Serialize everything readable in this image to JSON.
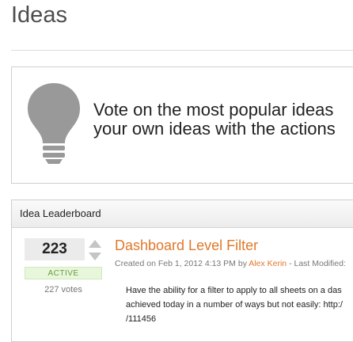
{
  "page": {
    "title": "Ideas"
  },
  "banner": {
    "line1": "Vote on the most popular ideas",
    "line2": "your own ideas with the actions"
  },
  "leaderboard": {
    "title": "Idea Leaderboard",
    "ideas": [
      {
        "vote_count": "223",
        "status": "ACTIVE",
        "votes_text": "227 votes",
        "title": "Dashboard Level Filter",
        "created_prefix": "Created on Feb 1, 2012 4:13 PM by",
        "author": "Alex Kerin",
        "modified_suffix": "- Last Modified:",
        "description_lines": [
          "Have the ability for a filter to apply to all sheets on a das",
          "achieved today in a number of ways but not easily: http:/",
          "/111456"
        ]
      }
    ]
  },
  "colors": {
    "accent": "#e0782a",
    "status_green_bg": "#e8f7dc",
    "status_green_text": "#6a9a3b",
    "bulb": "#999999"
  },
  "icons": {
    "banner": "lightbulb-icon",
    "vote_up": "caret-up-icon",
    "vote_down": "caret-down-icon"
  }
}
